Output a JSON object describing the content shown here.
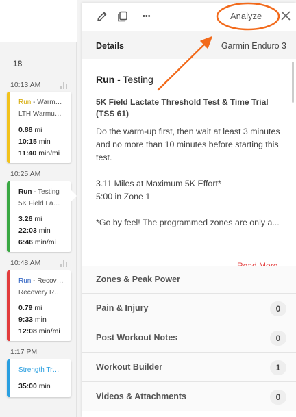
{
  "calendar": {
    "day_number": "18",
    "entries": [
      {
        "time": "10:13 AM",
        "sport": "Run",
        "title_suffix": " - Warm…",
        "subtitle": "LTH Warmu…",
        "metrics": [
          {
            "value": "0.88",
            "unit": " mi"
          },
          {
            "value": "10:15",
            "unit": " min"
          },
          {
            "value": "11:40",
            "unit": " min/mi"
          }
        ],
        "stripe_color": "#f2c21b",
        "title_color": "#d4a800",
        "selected": false
      },
      {
        "time": "10:25 AM",
        "sport": "Run",
        "title_suffix": " - Testing",
        "subtitle": "5K Field La…",
        "metrics": [
          {
            "value": "3.26",
            "unit": " mi"
          },
          {
            "value": "22:03",
            "unit": " min"
          },
          {
            "value": "6:46",
            "unit": " min/mi"
          }
        ],
        "stripe_color": "#3aa843",
        "title_color": "#222222",
        "selected": true
      },
      {
        "time": "10:48 AM",
        "sport": "Run",
        "title_suffix": " - Recov…",
        "subtitle": "Recovery R…",
        "metrics": [
          {
            "value": "0.79",
            "unit": " mi"
          },
          {
            "value": "9:33",
            "unit": " min"
          },
          {
            "value": "12:08",
            "unit": " min/mi"
          }
        ],
        "stripe_color": "#e23c3c",
        "title_color": "#2a5fc1",
        "selected": false
      },
      {
        "time": "1:17 PM",
        "sport": "Strength Tr…",
        "title_suffix": "",
        "subtitle": "",
        "metrics": [
          {
            "value": "35:00",
            "unit": " min"
          }
        ],
        "stripe_color": "#2a9fe0",
        "title_color": "#2a9fe0",
        "selected": false
      }
    ]
  },
  "panel": {
    "toolbar": {
      "edit_icon": "pencil-icon",
      "copy_icon": "copy-icon",
      "more_icon": "more-horizontal-icon",
      "more_label": "•••",
      "analyze_label": "Analyze",
      "close_icon": "close-icon"
    },
    "details_label": "Details",
    "device": "Garmin Enduro 3",
    "workout": {
      "sport": "Run",
      "title_rest": " - Testing",
      "name": "5K Field Lactate Threshold Test & Time Trial (TSS 61)",
      "description": [
        "Do the warm-up first, then wait at least 3 minutes and no more than 10 minutes before starting this test.",
        "3.11 Miles at Maximum 5K Effort*\n5:00 in Zone 1",
        "*Go by feel! The programmed zones are only a..."
      ],
      "read_more": "Read More"
    },
    "sections": [
      {
        "label": "Zones & Peak Power",
        "count": ""
      },
      {
        "label": "Pain & Injury",
        "count": "0"
      },
      {
        "label": "Post Workout Notes",
        "count": "0"
      },
      {
        "label": "Workout Builder",
        "count": "1"
      },
      {
        "label": "Videos & Attachments",
        "count": "0"
      }
    ]
  },
  "colors": {
    "annotation": "#f26a1b",
    "read_more": "#e44444"
  }
}
